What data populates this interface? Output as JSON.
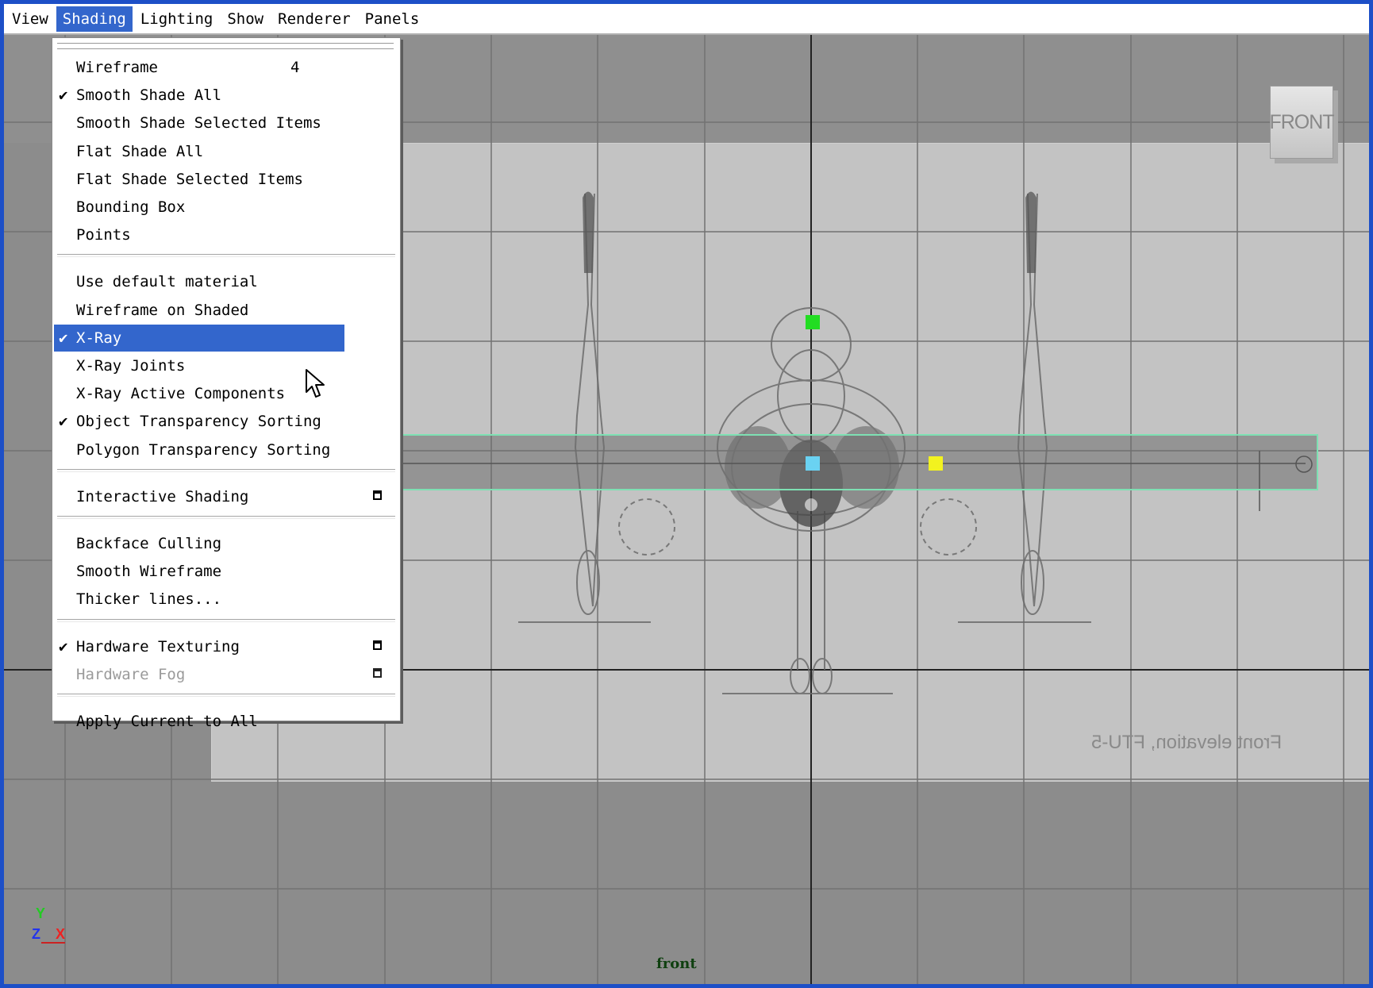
{
  "menubar": {
    "items": [
      "View",
      "Shading",
      "Lighting",
      "Show",
      "Renderer",
      "Panels"
    ],
    "active": "Shading"
  },
  "shading_menu": {
    "groups": [
      [
        {
          "label": "Wireframe",
          "shortcut": "4",
          "checked": false
        },
        {
          "label": "Smooth Shade All",
          "checked": true
        },
        {
          "label": "Smooth Shade Selected Items",
          "checked": false
        },
        {
          "label": "Flat Shade All",
          "checked": false
        },
        {
          "label": "Flat Shade Selected Items",
          "checked": false
        },
        {
          "label": "Bounding Box",
          "checked": false
        },
        {
          "label": "Points",
          "checked": false
        }
      ],
      [
        {
          "label": "Use default material",
          "checked": false
        },
        {
          "label": "Wireframe on Shaded",
          "checked": false
        },
        {
          "label": "X-Ray",
          "checked": true,
          "highlighted": true
        },
        {
          "label": "X-Ray Joints",
          "checked": false
        },
        {
          "label": "X-Ray Active Components",
          "checked": false
        },
        {
          "label": "Object Transparency Sorting",
          "checked": true
        },
        {
          "label": "Polygon Transparency Sorting",
          "checked": false
        }
      ],
      [
        {
          "label": "Interactive Shading",
          "checked": false,
          "option_box": true
        }
      ],
      [
        {
          "label": "Backface Culling",
          "checked": false
        },
        {
          "label": "Smooth Wireframe",
          "checked": false
        },
        {
          "label": "Thicker lines...",
          "checked": false
        }
      ],
      [
        {
          "label": "Hardware Texturing",
          "checked": true,
          "option_box": true
        },
        {
          "label": "Hardware Fog",
          "checked": false,
          "option_box": true,
          "disabled": true
        }
      ],
      [
        {
          "label": "Apply Current to All",
          "checked": false
        }
      ]
    ]
  },
  "viewport": {
    "camera_label": "front",
    "viewcube_label": "FRONT",
    "image_plane_caption": "Front elevation, FTU-5",
    "axis": {
      "y": "Y",
      "z": "Z",
      "x": "X"
    }
  },
  "colors": {
    "window_border": "#1d4fc7",
    "menu_highlight": "#3366cc",
    "viewport_bg": "#8c8c8c",
    "image_plane": "#c3c3c3",
    "selection_outline": "#7ee0b3",
    "handle_y": "#22dd22",
    "handle_center": "#6ad2f2",
    "handle_x": "#f2f21f"
  }
}
